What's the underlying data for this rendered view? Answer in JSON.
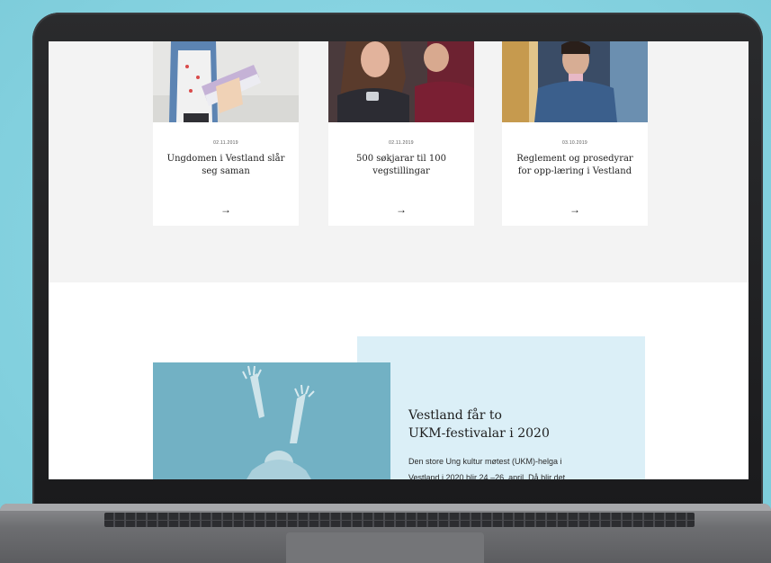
{
  "cards": [
    {
      "date": "02.11.2019",
      "title": "Ungdomen i Vestland slår seg saman",
      "arrow": "→"
    },
    {
      "date": "02.11.2019",
      "title": "500 søkjarar til 100 vegstillingar",
      "arrow": "→"
    },
    {
      "date": "03.10.2019",
      "title": "Reglement og prosedyrar for opp-læring i Vestland",
      "arrow": "→"
    }
  ],
  "feature": {
    "title_line1": "Vestland får to",
    "title_line2": "UKM-festivalar i 2020",
    "body_line1": "Den store Ung kultur møtest (UKM)-helga i",
    "body_line2": "Vestland i 2020 blir 24.–26. april. Då blir det"
  },
  "colors": {
    "background": "#86d3e1",
    "feature_box": "#dbeff7",
    "photo_tint": "#6aaabd"
  }
}
